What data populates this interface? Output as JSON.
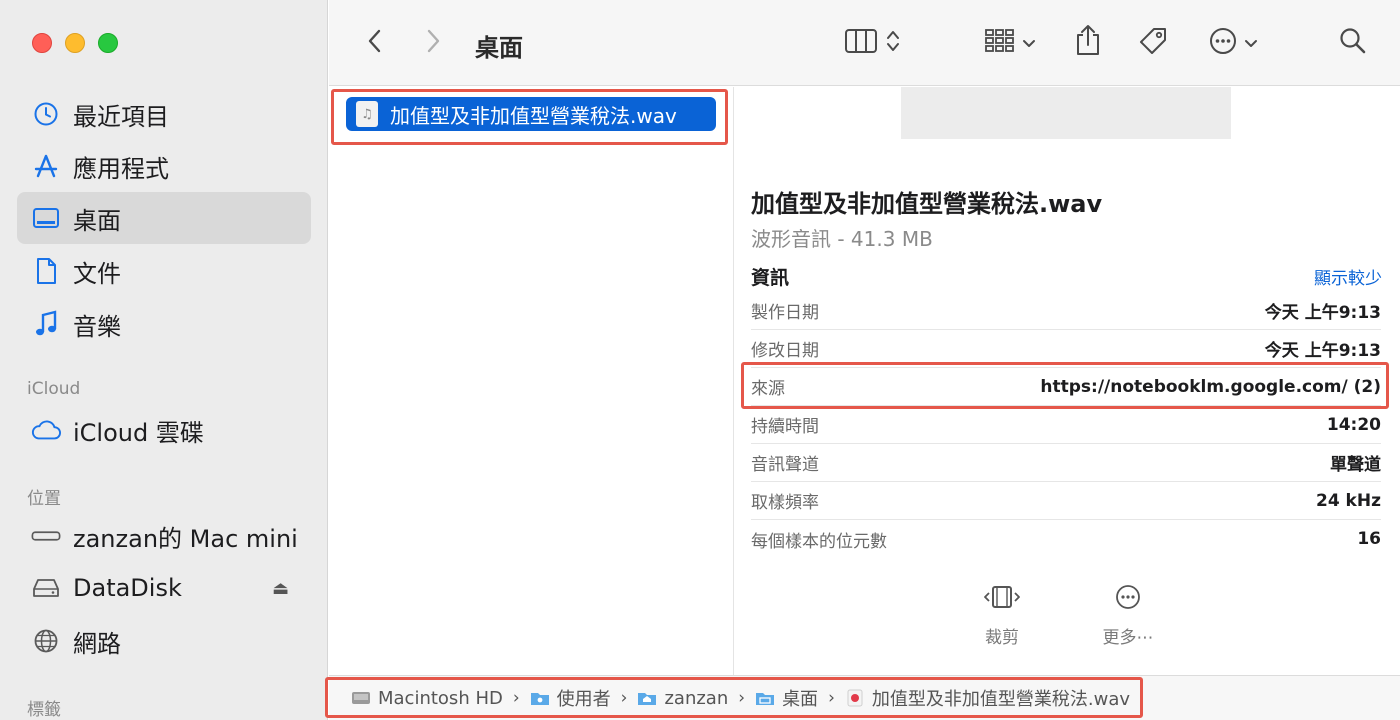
{
  "window": {
    "title": "桌面"
  },
  "sidebar": {
    "favorites": [
      {
        "label": "最近項目",
        "icon": "clock-icon"
      },
      {
        "label": "應用程式",
        "icon": "apps-icon"
      },
      {
        "label": "桌面",
        "icon": "desktop-icon",
        "selected": true
      },
      {
        "label": "文件",
        "icon": "document-icon"
      },
      {
        "label": "音樂",
        "icon": "music-note-icon"
      }
    ],
    "icloud_section": "iCloud",
    "icloud_item": "iCloud 雲碟",
    "locations_section": "位置",
    "locations": [
      {
        "label": "zanzan的 Mac mini",
        "icon": "mac-mini-icon"
      },
      {
        "label": "DataDisk",
        "icon": "disk-icon",
        "ejectable": true
      },
      {
        "label": "網路",
        "icon": "globe-icon"
      }
    ],
    "tags_section": "標籤"
  },
  "file_list": {
    "selected_file": "加值型及非加值型營業稅法.wav"
  },
  "preview": {
    "title": "加值型及非加值型營業稅法.wav",
    "subtitle": "波形音訊 - 41.3 MB",
    "info_header": "資訊",
    "show_less": "顯示較少",
    "rows": [
      {
        "key": "製作日期",
        "value": "今天 上午9:13"
      },
      {
        "key": "修改日期",
        "value": "今天 上午9:13"
      },
      {
        "key": "來源",
        "value": "https://notebooklm.google.com/ (2)"
      },
      {
        "key": "持續時間",
        "value": "14:20"
      },
      {
        "key": "音訊聲道",
        "value": "單聲道"
      },
      {
        "key": "取樣頻率",
        "value": "24 kHz"
      },
      {
        "key": "每個樣本的位元數",
        "value": "16"
      }
    ],
    "actions": [
      {
        "label": "裁剪",
        "icon": "trim-icon"
      },
      {
        "label": "更多⋯",
        "icon": "more-icon"
      }
    ]
  },
  "pathbar": {
    "crumbs": [
      {
        "label": "Macintosh HD",
        "icon": "hard-drive-icon"
      },
      {
        "label": "使用者",
        "icon": "folder-icon"
      },
      {
        "label": "zanzan",
        "icon": "home-folder-icon"
      },
      {
        "label": "桌面",
        "icon": "desktop-folder-icon"
      },
      {
        "label": "加值型及非加值型營業稅法.wav",
        "icon": "audio-file-icon"
      }
    ]
  },
  "colors": {
    "accent": "#0a63d6",
    "highlight_box": "#e5574a"
  }
}
